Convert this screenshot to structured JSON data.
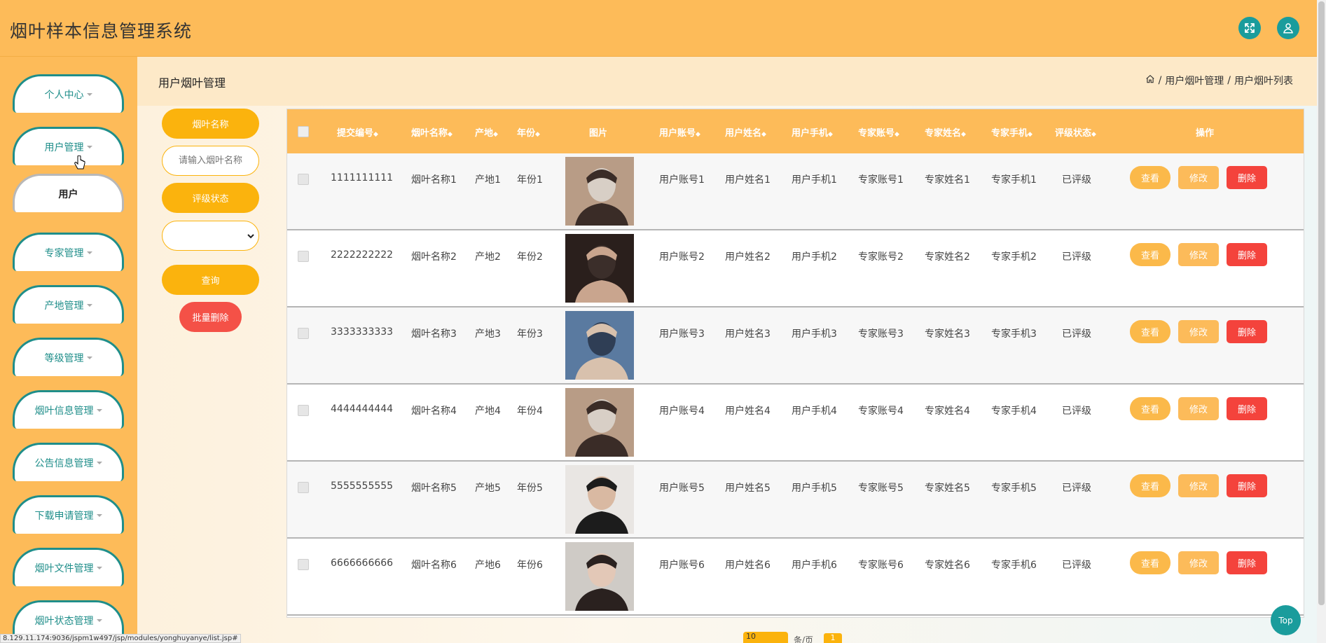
{
  "app": {
    "title": "烟叶样本信息管理系统"
  },
  "header": {
    "fullscreen_icon": "fullscreen-icon",
    "user_icon": "user-icon"
  },
  "sidebar": {
    "items": [
      {
        "label": "个人中心"
      },
      {
        "label": "用户管理"
      },
      {
        "label": "专家管理"
      },
      {
        "label": "产地管理"
      },
      {
        "label": "等级管理"
      },
      {
        "label": "烟叶信息管理"
      },
      {
        "label": "公告信息管理"
      },
      {
        "label": "下载申请管理"
      },
      {
        "label": "烟叶文件管理"
      },
      {
        "label": "烟叶状态管理"
      }
    ],
    "sub_item": "用户"
  },
  "page": {
    "title": "用户烟叶管理",
    "breadcrumb": [
      "用户烟叶管理",
      "用户烟叶列表"
    ]
  },
  "search": {
    "name_label": "烟叶名称",
    "name_placeholder": "请输入烟叶名称",
    "status_label": "评级状态",
    "status_value": "",
    "query_button": "查询",
    "batch_delete_button": "批量删除"
  },
  "table": {
    "headers": [
      "提交编号",
      "烟叶名称",
      "产地",
      "年份",
      "图片",
      "用户账号",
      "用户姓名",
      "用户手机",
      "专家账号",
      "专家姓名",
      "专家手机",
      "评级状态",
      "操作"
    ],
    "rows": [
      {
        "id": "1111111111",
        "name": "烟叶名称1",
        "origin": "产地1",
        "year": "年份1",
        "user_acct": "用户账号1",
        "user_name": "用户姓名1",
        "user_phone": "用户手机1",
        "exp_acct": "专家账号1",
        "exp_name": "专家姓名1",
        "exp_phone": "专家手机1",
        "status": "已评级"
      },
      {
        "id": "2222222222",
        "name": "烟叶名称2",
        "origin": "产地2",
        "year": "年份2",
        "user_acct": "用户账号2",
        "user_name": "用户姓名2",
        "user_phone": "用户手机2",
        "exp_acct": "专家账号2",
        "exp_name": "专家姓名2",
        "exp_phone": "专家手机2",
        "status": "已评级"
      },
      {
        "id": "3333333333",
        "name": "烟叶名称3",
        "origin": "产地3",
        "year": "年份3",
        "user_acct": "用户账号3",
        "user_name": "用户姓名3",
        "user_phone": "用户手机3",
        "exp_acct": "专家账号3",
        "exp_name": "专家姓名3",
        "exp_phone": "专家手机3",
        "status": "已评级"
      },
      {
        "id": "4444444444",
        "name": "烟叶名称4",
        "origin": "产地4",
        "year": "年份4",
        "user_acct": "用户账号4",
        "user_name": "用户姓名4",
        "user_phone": "用户手机4",
        "exp_acct": "专家账号4",
        "exp_name": "专家姓名4",
        "exp_phone": "专家手机4",
        "status": "已评级"
      },
      {
        "id": "5555555555",
        "name": "烟叶名称5",
        "origin": "产地5",
        "year": "年份5",
        "user_acct": "用户账号5",
        "user_name": "用户姓名5",
        "user_phone": "用户手机5",
        "exp_acct": "专家账号5",
        "exp_name": "专家姓名5",
        "exp_phone": "专家手机5",
        "status": "已评级"
      },
      {
        "id": "6666666666",
        "name": "烟叶名称6",
        "origin": "产地6",
        "year": "年份6",
        "user_acct": "用户账号6",
        "user_name": "用户姓名6",
        "user_phone": "用户手机6",
        "exp_acct": "专家账号6",
        "exp_name": "专家姓名6",
        "exp_phone": "专家手机6",
        "status": "已评级"
      }
    ],
    "actions": {
      "view": "查看",
      "edit": "修改",
      "delete": "删除"
    }
  },
  "pagination": {
    "page_size": "10",
    "per_page_text": "条/页",
    "current_page": "1"
  },
  "status_bar_url": "8.129.11.174:9036/jspm1w497/jsp/modules/yonghuyanye/list.jsp#",
  "top_button": "Top",
  "colors": {
    "primary": "#fdbb59",
    "accent_teal": "#1a9c9c",
    "danger": "#f4433c",
    "button_orange": "#fbb30d"
  }
}
